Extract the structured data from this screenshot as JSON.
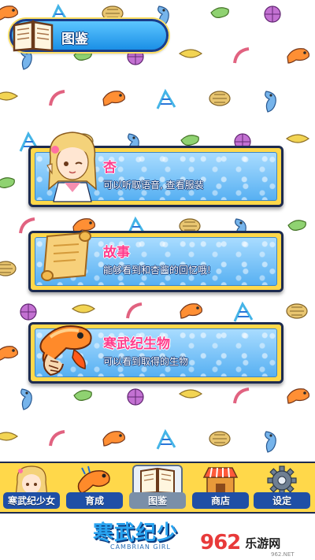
{
  "header": {
    "title": "图鉴",
    "icon": "open-book-icon"
  },
  "cards": [
    {
      "title": "杏",
      "subtitle": "可以听取语音, 查看服装",
      "icon": "anime-girl-portrait"
    },
    {
      "title": "故事",
      "subtitle": "能够看到和杏酱的回忆哦!",
      "icon": "scroll-icon"
    },
    {
      "title": "寒武纪生物",
      "subtitle": "可以看到取得的生物",
      "icon": "anomalocaris-icon"
    }
  ],
  "nav": [
    {
      "label": "寒武纪少女",
      "icon": "girl-avatar-icon"
    },
    {
      "label": "育成",
      "icon": "creature-icon"
    },
    {
      "label": "图鉴",
      "icon": "book-icon",
      "active": true
    },
    {
      "label": "商店",
      "icon": "shop-icon"
    },
    {
      "label": "设定",
      "icon": "gear-icon"
    }
  ],
  "footer": {
    "logo": "寒武纪少",
    "logo_sub": "CAMBRIAN GIRL",
    "watermark_num": "962",
    "watermark_text": "乐游网",
    "watermark_domain": "962.NET"
  },
  "colors": {
    "card_frame": "#ffd84a",
    "card_bg": "#57b0f2",
    "title_pink": "#ff3d8c",
    "nav_blue": "#1f4fa6"
  }
}
